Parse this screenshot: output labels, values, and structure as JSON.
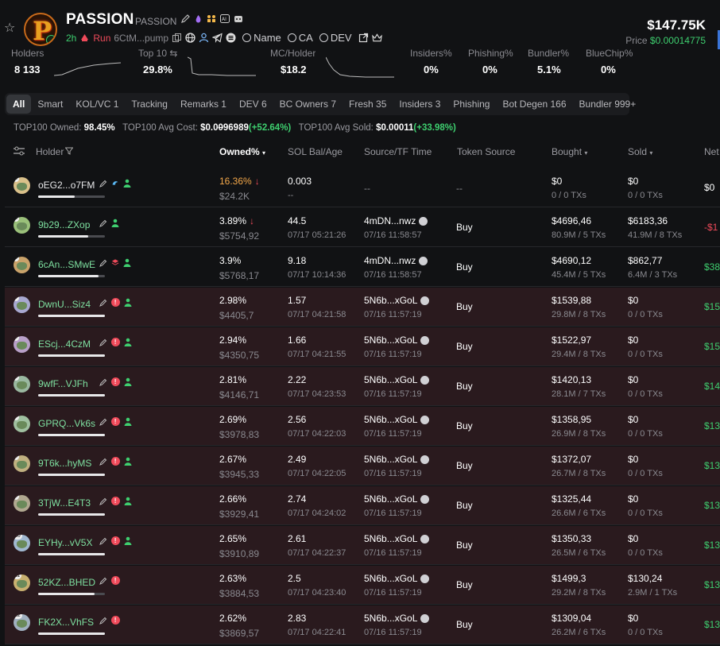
{
  "token": {
    "name": "PASSION",
    "symbol": "PASSION",
    "age": "2h",
    "run_label": "Run",
    "address": "6CtM...pump",
    "search_name": "Name",
    "search_ca": "CA",
    "search_dev": "DEV",
    "market_cap": "$147.75K",
    "price_label": "Price",
    "price_value": "$0.00014775"
  },
  "stats": [
    {
      "label": "Holders",
      "value": "8 133"
    },
    {
      "label": "Top 10",
      "value": "29.8%"
    },
    {
      "label": "MC/Holder",
      "value": "$18.2"
    },
    {
      "label": "Insiders%",
      "value": "0%"
    },
    {
      "label": "Phishing%",
      "value": "0%"
    },
    {
      "label": "Bundler%",
      "value": "5.1%"
    },
    {
      "label": "BlueChip%",
      "value": "0%"
    }
  ],
  "tabs": [
    "All",
    "Smart",
    "KOL/VC 1",
    "Tracking",
    "Remarks 1",
    "DEV 6",
    "BC Owners 7",
    "Fresh 35",
    "Insiders 3",
    "Phishing",
    "Bot Degen 166",
    "Bundler 999+"
  ],
  "summary": {
    "owned_label": "TOP100 Owned:",
    "owned_value": "98.45%",
    "cost_label": "TOP100 Avg Cost:",
    "cost_value": "$0.0",
    "cost_strike": "0",
    "cost_rest": "96989",
    "cost_change": "(+52.64%)",
    "sold_label": "TOP100 Avg Sold:",
    "sold_value": "$0.00011",
    "sold_change": "(+33.98%)"
  },
  "columns": {
    "holder": "Holder",
    "owned": "Owned%",
    "sol": "SOL Bal/Age",
    "source": "Source/TF Time",
    "token_source": "Token Source",
    "bought": "Bought",
    "sold": "Sold",
    "net": "Net"
  },
  "rows": [
    {
      "rank": "1",
      "addr": "oEG2...o7FM",
      "owned": "16.36%",
      "owned_usd": "$24.2K",
      "sol": "0.003",
      "age": "--",
      "source": "--",
      "tf": "",
      "tsrc": "--",
      "bought": "$0",
      "bought_tx": "0 / 0 TXs",
      "sold": "$0",
      "sold_tx": "0 / 0 TXs",
      "net": "$0"
    },
    {
      "rank": "2",
      "addr": "9b29...ZXop",
      "owned": "3.89%",
      "owned_usd": "$5754,92",
      "sol": "44.5",
      "age": "07/17 05:21:26",
      "source": "4mDN...nwz",
      "tf": "07/16 11:58:57",
      "tsrc": "Buy",
      "bought": "$4696,46",
      "bought_tx": "80.9M / 5 TXs",
      "sold": "$6183,36",
      "sold_tx": "41.9M / 8 TXs",
      "net": "-$1"
    },
    {
      "rank": "3",
      "addr": "6cAn...SMwE",
      "owned": "3.9%",
      "owned_usd": "$5768,17",
      "sol": "9.18",
      "age": "07/17 10:14:36",
      "source": "4mDN...nwz",
      "tf": "07/16 11:58:57",
      "tsrc": "Buy",
      "bought": "$4690,12",
      "bought_tx": "45.4M / 5 TXs",
      "sold": "$862,77",
      "sold_tx": "6.4M / 3 TXs",
      "net": "$38"
    },
    {
      "rank": "4",
      "addr": "DwnU...Siz4",
      "owned": "2.98%",
      "owned_usd": "$4405,7",
      "sol": "1.57",
      "age": "07/17 04:21:58",
      "source": "5N6b...xGoL",
      "tf": "07/16 11:57:19",
      "tsrc": "Buy",
      "bought": "$1539,88",
      "bought_tx": "29.8M / 8 TXs",
      "sold": "$0",
      "sold_tx": "0 / 0 TXs",
      "net": "$15"
    },
    {
      "rank": "5",
      "addr": "EScj...4CzM",
      "owned": "2.94%",
      "owned_usd": "$4350,75",
      "sol": "1.66",
      "age": "07/17 04:21:55",
      "source": "5N6b...xGoL",
      "tf": "07/16 11:57:19",
      "tsrc": "Buy",
      "bought": "$1522,97",
      "bought_tx": "29.4M / 8 TXs",
      "sold": "$0",
      "sold_tx": "0 / 0 TXs",
      "net": "$15"
    },
    {
      "rank": "6",
      "addr": "9wfF...VJFh",
      "owned": "2.81%",
      "owned_usd": "$4146,71",
      "sol": "2.22",
      "age": "07/17 04:23:53",
      "source": "5N6b...xGoL",
      "tf": "07/16 11:57:19",
      "tsrc": "Buy",
      "bought": "$1420,13",
      "bought_tx": "28.1M / 7 TXs",
      "sold": "$0",
      "sold_tx": "0 / 0 TXs",
      "net": "$14"
    },
    {
      "rank": "7",
      "addr": "GPRQ...Vk6s",
      "owned": "2.69%",
      "owned_usd": "$3978,83",
      "sol": "2.56",
      "age": "07/17 04:22:03",
      "source": "5N6b...xGoL",
      "tf": "07/16 11:57:19",
      "tsrc": "Buy",
      "bought": "$1358,95",
      "bought_tx": "26.9M / 8 TXs",
      "sold": "$0",
      "sold_tx": "0 / 0 TXs",
      "net": "$13"
    },
    {
      "rank": "8",
      "addr": "9T6k...hyMS",
      "owned": "2.67%",
      "owned_usd": "$3945,33",
      "sol": "2.49",
      "age": "07/17 04:22:05",
      "source": "5N6b...xGoL",
      "tf": "07/16 11:57:19",
      "tsrc": "Buy",
      "bought": "$1372,07",
      "bought_tx": "26.7M / 8 TXs",
      "sold": "$0",
      "sold_tx": "0 / 0 TXs",
      "net": "$13"
    },
    {
      "rank": "9",
      "addr": "3TjW...E4T3",
      "owned": "2.66%",
      "owned_usd": "$3929,41",
      "sol": "2.74",
      "age": "07/17 04:24:02",
      "source": "5N6b...xGoL",
      "tf": "07/16 11:57:19",
      "tsrc": "Buy",
      "bought": "$1325,44",
      "bought_tx": "26.6M / 6 TXs",
      "sold": "$0",
      "sold_tx": "0 / 0 TXs",
      "net": "$13"
    },
    {
      "rank": "10",
      "addr": "EYHy...vV5X",
      "owned": "2.65%",
      "owned_usd": "$3910,89",
      "sol": "2.61",
      "age": "07/17 04:22:37",
      "source": "5N6b...xGoL",
      "tf": "07/16 11:57:19",
      "tsrc": "Buy",
      "bought": "$1350,33",
      "bought_tx": "26.5M / 6 TXs",
      "sold": "$0",
      "sold_tx": "0 / 0 TXs",
      "net": "$13"
    },
    {
      "rank": "11",
      "addr": "52KZ...BHED",
      "owned": "2.63%",
      "owned_usd": "$3884,53",
      "sol": "2.5",
      "age": "07/17 04:23:40",
      "source": "5N6b...xGoL",
      "tf": "07/16 11:57:19",
      "tsrc": "Buy",
      "bought": "$1499,3",
      "bought_tx": "29.2M / 8 TXs",
      "sold": "$130,24",
      "sold_tx": "2.9M / 1 TXs",
      "net": "$13"
    },
    {
      "rank": "12",
      "addr": "FK2X...VhFS",
      "owned": "2.62%",
      "owned_usd": "$3869,57",
      "sol": "2.83",
      "age": "07/17 04:22:41",
      "source": "5N6b...xGoL",
      "tf": "07/16 11:57:19",
      "tsrc": "Buy",
      "bought": "$1309,04",
      "bought_tx": "26.2M / 6 TXs",
      "sold": "$0",
      "sold_tx": "0 / 0 TXs",
      "net": "$13"
    }
  ],
  "holding_fraction": [
    0.55,
    0.75,
    0.9,
    1,
    1,
    1,
    1,
    1,
    1,
    1,
    0.85,
    1
  ],
  "colors": {
    "green": "#3ecf6f",
    "red": "#ef4a5a",
    "orange": "#f4a84a",
    "row_red_bg": "#2a1a1e"
  }
}
